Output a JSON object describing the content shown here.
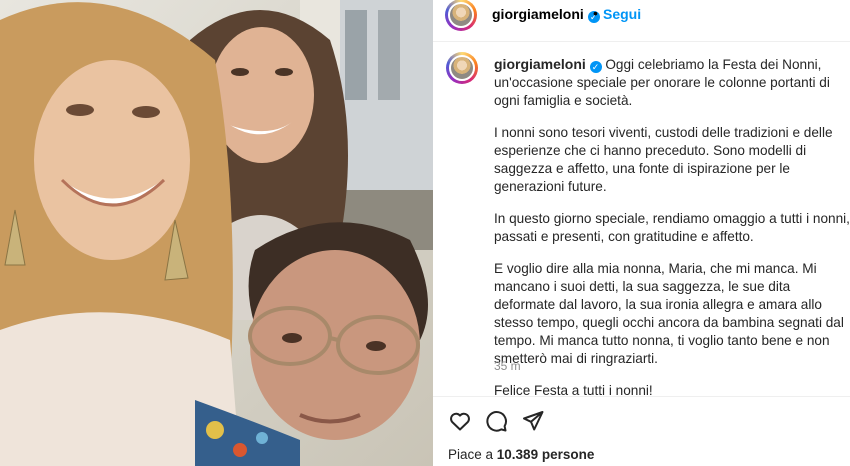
{
  "photo": {
    "alt_subjects": [
      "woman-smiling",
      "woman-behind",
      "grandmother-with-glasses"
    ]
  },
  "header": {
    "username": "giorgiameloni",
    "separator": "•",
    "follow_label": "Segui"
  },
  "post": {
    "username": "giorgiameloni",
    "caption_first": "Oggi celebriamo la Festa dei Nonni, un'occasione speciale per onorare le colonne portanti di ogni famiglia e società.",
    "paragraphs": [
      "I nonni sono tesori viventi, custodi delle tradizioni e delle esperienze che ci hanno preceduto. Sono modelli di saggezza e affetto, una fonte di ispirazione per le generazioni future.",
      "In questo giorno speciale, rendiamo omaggio a tutti i nonni, passati e presenti, con gratitudine e affetto.",
      "E voglio dire alla mia nonna, Maria, che mi manca. Mi mancano i suoi detti, la sua saggezza, le sue dita deformate dal lavoro, la sua ironia allegra e amara allo stesso tempo, quegli occhi ancora da bambina segnati dal tempo. Mi manca tutto nonna, ti voglio tanto bene e non smetterò mai di ringraziarti.",
      "Felice Festa a tutti i nonni!"
    ],
    "timestamp": "35 m"
  },
  "actions": {
    "icons": [
      "heart-icon",
      "comment-icon",
      "share-icon"
    ],
    "likes_prefix": "Piace a ",
    "likes_count": "10.389",
    "likes_suffix": " persone"
  },
  "colors": {
    "accent": "#0095f6",
    "text": "#262626",
    "muted": "#8e8e8e"
  }
}
